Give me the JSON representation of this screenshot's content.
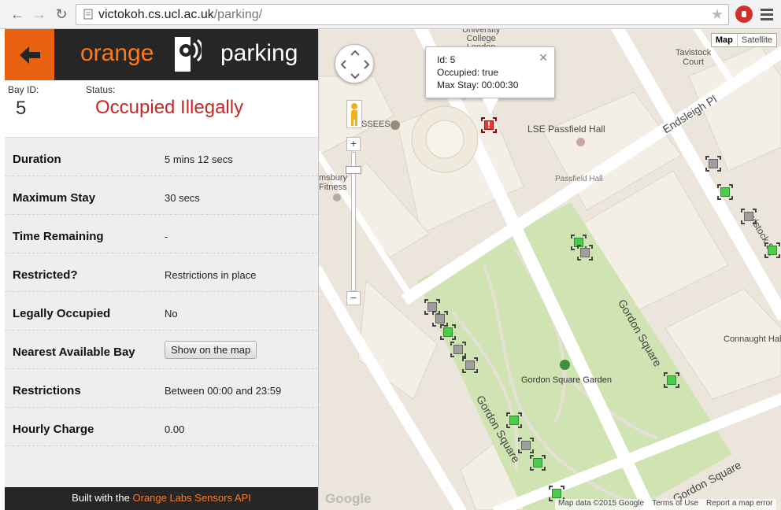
{
  "browser": {
    "url_host": "victokoh.cs.ucl.ac.uk",
    "url_path": "/parking/"
  },
  "header": {
    "brand_left": "orange",
    "brand_right": "parking"
  },
  "bay": {
    "id_label": "Bay ID:",
    "id_value": "5",
    "status_label": "Status:",
    "status_value": "Occupied Illegally",
    "status_color": "#c62828"
  },
  "details": {
    "duration_label": "Duration",
    "duration_value": "5 mins 12 secs",
    "max_stay_label": "Maximum Stay",
    "max_stay_value": "30 secs",
    "time_remaining_label": "Time Remaining",
    "time_remaining_value": "-",
    "restricted_label": "Restricted?",
    "restricted_value": "Restrictions in place",
    "legally_label": "Legally Occupied",
    "legally_value": "No",
    "nearest_label": "Nearest Available Bay",
    "nearest_button": "Show on the map",
    "restrictions_label": "Restrictions",
    "restrictions_value": "Between 00:00 and 23:59",
    "hourly_label": "Hourly Charge",
    "hourly_value": "0.00"
  },
  "footer": {
    "prefix": "Built with the ",
    "link": "Orange Labs Sensors API"
  },
  "map": {
    "type_map": "Map",
    "type_satellite": "Satellite",
    "infowindow": {
      "id_line": "Id: 5",
      "occupied_line": "Occupied: true",
      "max_stay_line": "Max Stay: 00:00:30"
    },
    "labels": {
      "university_college_london": "University\nCollege\nLondon",
      "tavistock_court": "Tavistock\nCourt",
      "ssees": "SSEES",
      "lse_passfield_hall": "LSE Passfield Hall",
      "passfield_hall": "Passfield Hall",
      "bloomsbury_fitness": "msbury\nFitness",
      "endsleigh_pl": "Endsleigh Pl",
      "gordon_square_east": "Gordon Square",
      "gordon_square_west": "Gordon Square",
      "gordon_square_south": "Gordon Square",
      "gordon_square_garden": "Gordon Square Garden",
      "connaught_hall": "Connaught Hall",
      "tavistock_sq": "vistock Sq"
    },
    "attribution": "Map data ©2015 Google",
    "terms": "Terms of Use",
    "report": "Report a map error",
    "google": "Google",
    "colors": {
      "available": "#4ccb4c",
      "occupied": "#9e9e9e",
      "illegal": "#e53935"
    }
  }
}
